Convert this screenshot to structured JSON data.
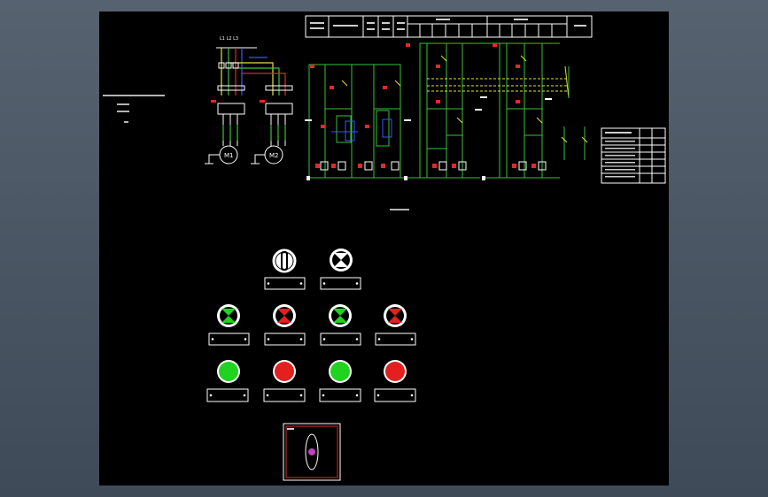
{
  "drawing": {
    "motor_note_lines": [
      "",
      "",
      ""
    ],
    "motor_m1": "M1",
    "motor_m2": "M2",
    "main_circuit_caption": "",
    "control_circuit_caption": "",
    "title_block_cells": [
      "",
      "",
      "",
      "",
      "",
      "",
      "",
      "",
      ""
    ],
    "legend_table": {
      "header": [
        "",
        "",
        ""
      ],
      "rows": [
        [
          "",
          "",
          ""
        ],
        [
          "",
          "",
          ""
        ],
        [
          "",
          "",
          ""
        ],
        [
          "",
          "",
          ""
        ],
        [
          "",
          "",
          ""
        ],
        [
          "",
          "",
          ""
        ]
      ]
    }
  },
  "panel": {
    "selector_label": "",
    "indicator_label": "",
    "start_lamp_labels": [
      "",
      "",
      "",
      ""
    ],
    "stop_button_labels": [
      "",
      "",
      "",
      ""
    ],
    "joystick_label": ""
  },
  "colors": {
    "sheet_bg": "#000000",
    "viewport_bg": "#4e5a69",
    "wire_green": "#39c23a",
    "wire_yellow": "#e6e23a",
    "wire_red": "#e02a2a",
    "wire_blue": "#3a55ff",
    "lamp_green": "#1fd31f",
    "lamp_red": "#e31f1f",
    "joystick_dot": "#c040c0"
  }
}
